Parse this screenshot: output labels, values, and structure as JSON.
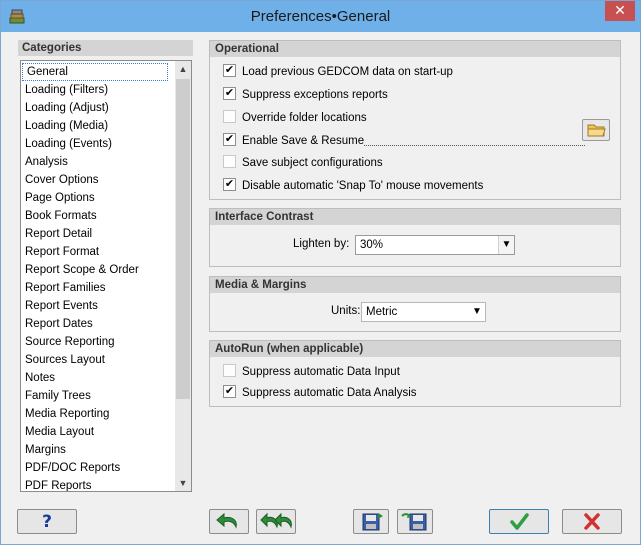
{
  "window": {
    "title": "Preferences•General",
    "close_label": "✕"
  },
  "categories": {
    "header": "Categories",
    "items": [
      "General",
      "Loading (Filters)",
      "Loading (Adjust)",
      "Loading (Media)",
      "Loading (Events)",
      "Analysis",
      "Cover Options",
      "Page Options",
      "Book Formats",
      "Report Detail",
      "Report Format",
      "Report Scope & Order",
      "Report Families",
      "Report Events",
      "Report Dates",
      "Source Reporting",
      "Sources Layout",
      "Notes",
      "Family Trees",
      "Media Reporting",
      "Media Layout",
      "Margins",
      "PDF/DOC Reports",
      "PDF Reports"
    ],
    "selected": "General"
  },
  "operational": {
    "header": "Operational",
    "options": [
      {
        "label": "Load previous GEDCOM data on start-up",
        "checked": true
      },
      {
        "label": "Suppress exceptions reports",
        "checked": true
      },
      {
        "label": "Override folder locations",
        "checked": false
      },
      {
        "label": "Enable Save & Resume",
        "checked": true
      },
      {
        "label": "Save subject configurations",
        "checked": false
      },
      {
        "label": "Disable automatic 'Snap To' mouse movements",
        "checked": true
      }
    ]
  },
  "contrast": {
    "header": "Interface Contrast",
    "label": "Lighten by:",
    "value": "30%"
  },
  "media": {
    "header": "Media & Margins",
    "label": "Units:",
    "value": "Metric"
  },
  "autorun": {
    "header": "AutoRun (when applicable)",
    "options": [
      {
        "label": "Suppress automatic Data Input",
        "checked": false
      },
      {
        "label": "Suppress automatic Data Analysis",
        "checked": true
      }
    ]
  },
  "buttons": {
    "help": "?"
  },
  "colors": {
    "titlebar": "#6fb0e8",
    "ok_green": "#2ea043",
    "cancel_red": "#d32f2f",
    "undo_green": "#2e8b3a"
  }
}
